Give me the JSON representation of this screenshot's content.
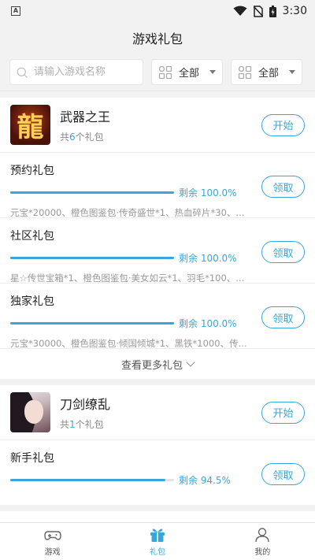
{
  "statusbar": {
    "time": "3:30"
  },
  "header": {
    "title": "游戏礼包"
  },
  "filters": {
    "search_placeholder": "请输入游戏名称",
    "dropdown1": "全部",
    "dropdown2": "全部"
  },
  "games": [
    {
      "name": "武器之王",
      "icon_char": "龍",
      "sub_prefix": "共",
      "count": "6",
      "sub_suffix": "个礼包",
      "start_label": "开始",
      "gifts": [
        {
          "title": "预约礼包",
          "remain_text": "剩余 100.0%",
          "remain": 1.0,
          "desc": "元宝*20000、橙色图鉴包·传奇盛世*1、热血碎片*30、...",
          "action": "领取"
        },
        {
          "title": "社区礼包",
          "remain_text": "剩余 100.0%",
          "remain": 1.0,
          "desc": "星☆传世宝箱*1、橙色图鉴包·美女如云*1、羽毛*100、...",
          "action": "领取"
        },
        {
          "title": "独家礼包",
          "remain_text": "剩余 100.0%",
          "remain": 1.0,
          "desc": "元宝*30000、橙色图鉴包·倾国倾城*1、黑铁*1000、传...",
          "action": "领取"
        }
      ],
      "more_label": "查看更多礼包"
    },
    {
      "name": "刀剑缭乱",
      "sub_prefix": "共",
      "count": "1",
      "sub_suffix": "个礼包",
      "start_label": "开始",
      "gifts": [
        {
          "title": "新手礼包",
          "remain_text": "剩余 94.5%",
          "remain": 0.945,
          "desc": "",
          "action": "领取"
        }
      ]
    }
  ],
  "tabs": [
    {
      "label": "游戏",
      "icon": "gamepad-icon"
    },
    {
      "label": "礼包",
      "icon": "gift-icon",
      "active": true
    },
    {
      "label": "我的",
      "icon": "user-icon"
    }
  ],
  "colors": {
    "accent": "#39a6d8",
    "background": "#f2f2f2"
  }
}
